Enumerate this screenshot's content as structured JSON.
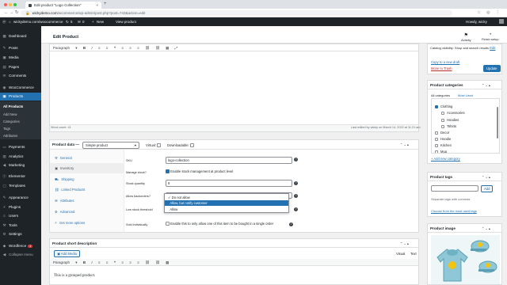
{
  "browser": {
    "tab_title": "Edit product \"Logo Collection\"",
    "url_host": "wickydemo.com",
    "url_path": "/wcommerce/wp-admin/post.php?post=743&action=edit",
    "traffic_colors": [
      "#ff5f57",
      "#febc2e",
      "#28c840"
    ]
  },
  "adminbar": {
    "site": "wickydemo.com/woocommerce",
    "updates": "5",
    "comments": "0",
    "new": "New",
    "view": "View product",
    "howdy": "Howdy, wicky"
  },
  "sidebar": {
    "items": [
      {
        "label": "Dashboard",
        "icon": "dashboard-icon"
      },
      {
        "label": "Posts",
        "icon": "pin-icon"
      },
      {
        "label": "Media",
        "icon": "media-icon"
      },
      {
        "label": "Pages",
        "icon": "page-icon"
      },
      {
        "label": "Comments",
        "icon": "comment-icon"
      },
      {
        "label": "WooCommerce",
        "icon": "woo-icon"
      },
      {
        "label": "Products",
        "icon": "box-icon"
      }
    ],
    "sub": [
      "All Products",
      "Add New",
      "Categories",
      "Tags",
      "Attributes"
    ],
    "items2": [
      {
        "label": "Payments",
        "icon": "card-icon"
      },
      {
        "label": "Analytics",
        "icon": "chart-icon"
      },
      {
        "label": "Marketing",
        "icon": "megaphone-icon"
      },
      {
        "label": "Elementor",
        "icon": "elementor-icon"
      },
      {
        "label": "Templates",
        "icon": "folder-icon"
      },
      {
        "label": "Appearance",
        "icon": "brush-icon"
      },
      {
        "label": "Plugins",
        "icon": "plug-icon"
      },
      {
        "label": "Users",
        "icon": "user-icon"
      },
      {
        "label": "Tools",
        "icon": "wrench-icon"
      },
      {
        "label": "Settings",
        "icon": "settings-icon"
      },
      {
        "label": "Wordfence",
        "icon": "shield-icon"
      }
    ],
    "wordfence_badge": "1",
    "collapse": "Collapse menu"
  },
  "header": {
    "title": "Edit Product",
    "activity": "Activity",
    "finish_setup": "Finish setup"
  },
  "editor": {
    "format": "Paragraph",
    "word_count": "Word count: 41",
    "last_edited": "Last edited by wicky on March 14, 2022 at 11:21 am"
  },
  "product_data": {
    "label": "Product data —",
    "type": "Simple product",
    "virtual": "Virtual:",
    "downloadable": "Downloadable:",
    "tabs": [
      "General",
      "Inventory",
      "Shipping",
      "Linked Products",
      "Attributes",
      "Advanced",
      "Get more options"
    ],
    "sku_label": "SKU",
    "sku_value": "logo-collection",
    "manage_label": "Manage stock?",
    "manage_text": "Enable stock management at product level",
    "qty_label": "Stock quantity",
    "qty_value": "9",
    "backorders_label": "Allow backorders?",
    "low_label": "Low stock threshold",
    "sold_label": "Sold individually",
    "sold_text": "Enable this to only allow one of this item to be bought in a single order",
    "options": [
      "Do not allow",
      "Allow, but notify customer",
      "Allow"
    ]
  },
  "short_desc": {
    "title": "Product short description",
    "add_media": "Add Media",
    "visual": "Visual",
    "text": "Text",
    "format": "Paragraph",
    "content": "This is a grouped product."
  },
  "publish": {
    "catalog": "Catalog visibility: Shop and search results",
    "edit": "Edit",
    "copy": "Copy to a new draft",
    "trash": "Move to Trash",
    "update": "Update"
  },
  "categories": {
    "title": "Product categories",
    "tab_all": "All categories",
    "tab_most": "Most Used",
    "items": [
      {
        "label": "Clothing",
        "checked": true,
        "level": 0
      },
      {
        "label": "Accessories",
        "checked": false,
        "level": 1
      },
      {
        "label": "Hoodies",
        "checked": false,
        "level": 1
      },
      {
        "label": "Tshirts",
        "checked": false,
        "level": 1
      },
      {
        "label": "Decor",
        "checked": false,
        "level": 0
      },
      {
        "label": "Hoodie",
        "checked": false,
        "level": 0
      },
      {
        "label": "Kitchen",
        "checked": false,
        "level": 0
      },
      {
        "label": "Mug",
        "checked": false,
        "level": 0
      }
    ],
    "add_new": "+ Add new category"
  },
  "tags": {
    "title": "Product tags",
    "add": "Add",
    "hint": "Separate tags with commas",
    "choose": "Choose from the most used tags"
  },
  "image": {
    "title": "Product image"
  }
}
